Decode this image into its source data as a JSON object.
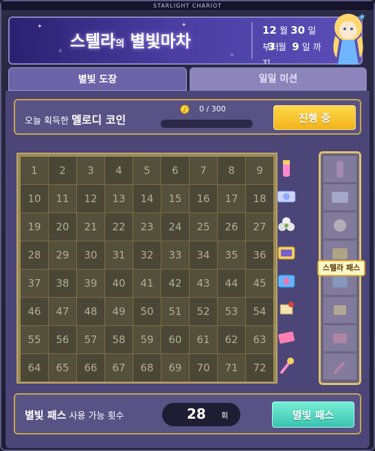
{
  "window": {
    "topbar_title": "STARLIGHT CHARIOT"
  },
  "banner": {
    "title_part1": "스텔라",
    "title_part2": "의",
    "title_part3": "별빛마차",
    "start": {
      "month": "12",
      "month_unit": "월",
      "day": "30",
      "day_unit": "일",
      "suffix": "부터"
    },
    "end": {
      "month": "3",
      "month_unit": "월",
      "day": "9",
      "day_unit": "일",
      "suffix": "까지"
    }
  },
  "tabs": [
    {
      "label": "별빛 도장",
      "active": true
    },
    {
      "label": "일일 미션",
      "active": false
    }
  ],
  "coin": {
    "label_prefix": "오늘 획득한",
    "label_bold": "멜로디 코인",
    "count": "0 / 300",
    "progress": 0,
    "button_label": "진행 중"
  },
  "grid": {
    "numbers": [
      1,
      2,
      3,
      4,
      5,
      6,
      7,
      8,
      9,
      10,
      11,
      12,
      13,
      14,
      15,
      16,
      17,
      18,
      19,
      20,
      21,
      22,
      23,
      24,
      25,
      26,
      27,
      28,
      29,
      30,
      31,
      32,
      33,
      34,
      35,
      36,
      37,
      38,
      39,
      40,
      41,
      42,
      43,
      44,
      45,
      46,
      47,
      48,
      49,
      50,
      51,
      52,
      53,
      54,
      55,
      56,
      57,
      58,
      59,
      60,
      61,
      62,
      63,
      64,
      65,
      66,
      67,
      68,
      69,
      70,
      71,
      72
    ]
  },
  "rewards": [
    {
      "icon": "potion-vial-icon"
    },
    {
      "icon": "ticket-icon"
    },
    {
      "icon": "flower-icon"
    },
    {
      "icon": "coupon-icon"
    },
    {
      "icon": "gem-ticket-icon"
    },
    {
      "icon": "scroll-icon"
    },
    {
      "icon": "pink-card-icon"
    },
    {
      "icon": "magic-wand-icon"
    }
  ],
  "pass_tooltip": "스텔라 패스",
  "bottom": {
    "label_bold": "별빛 패스",
    "label_rest": "사용 가능 횟수",
    "count": "28",
    "count_unit": "회",
    "button_label": "별빛 패스"
  },
  "colors": {
    "gold_border": "#c9a84f",
    "yellow_button": "#ffd84a",
    "teal_button": "#39c3b0",
    "banner_blue": "#4a3ca0"
  }
}
